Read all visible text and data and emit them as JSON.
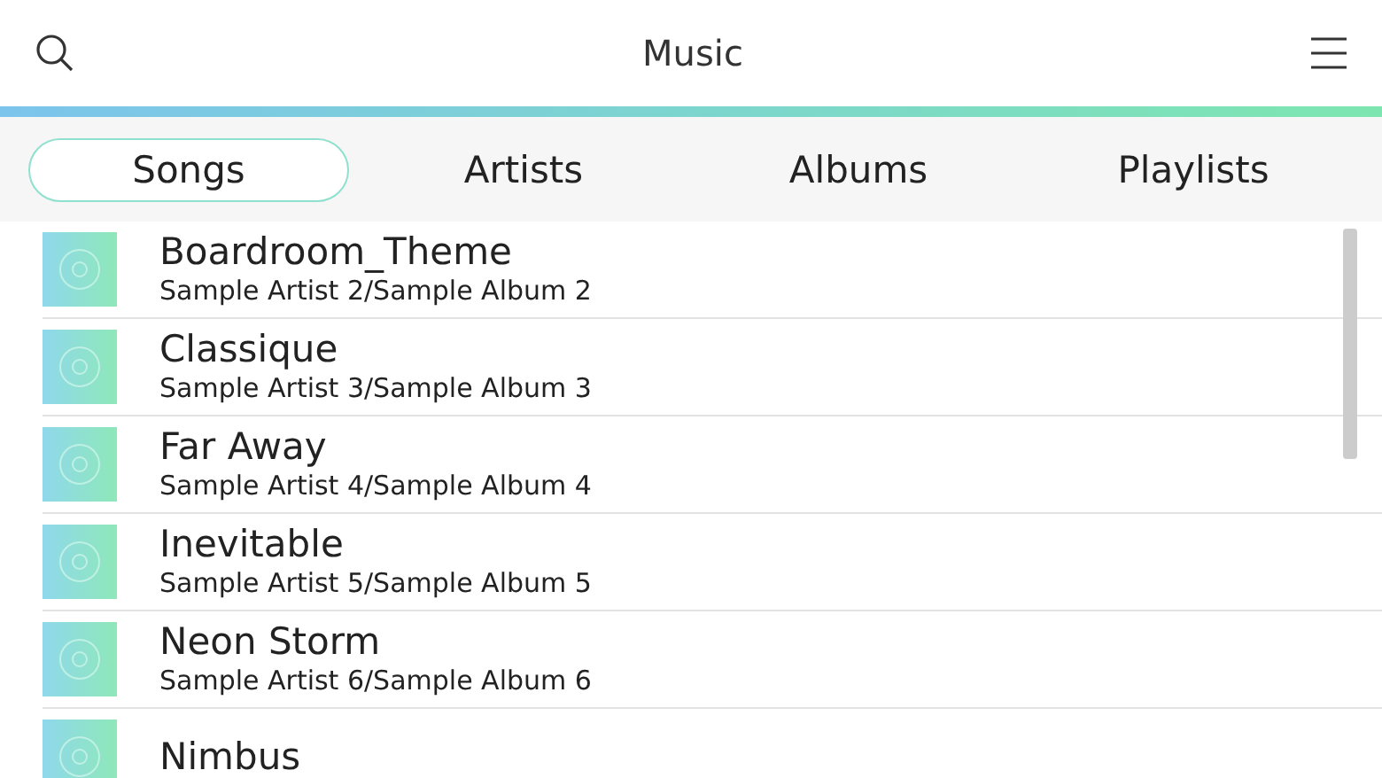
{
  "header": {
    "title": "Music"
  },
  "tabs": [
    {
      "label": "Songs",
      "selected": true
    },
    {
      "label": "Artists",
      "selected": false
    },
    {
      "label": "Albums",
      "selected": false
    },
    {
      "label": "Playlists",
      "selected": false
    }
  ],
  "songs": [
    {
      "title": "Boardroom_Theme",
      "subtitle": "Sample Artist 2/Sample Album 2"
    },
    {
      "title": "Classique",
      "subtitle": "Sample Artist 3/Sample Album 3"
    },
    {
      "title": "Far Away",
      "subtitle": "Sample Artist 4/Sample Album 4"
    },
    {
      "title": "Inevitable",
      "subtitle": "Sample Artist 5/Sample Album 5"
    },
    {
      "title": "Neon Storm",
      "subtitle": "Sample Artist 6/Sample Album 6"
    },
    {
      "title": "Nimbus"
    }
  ]
}
